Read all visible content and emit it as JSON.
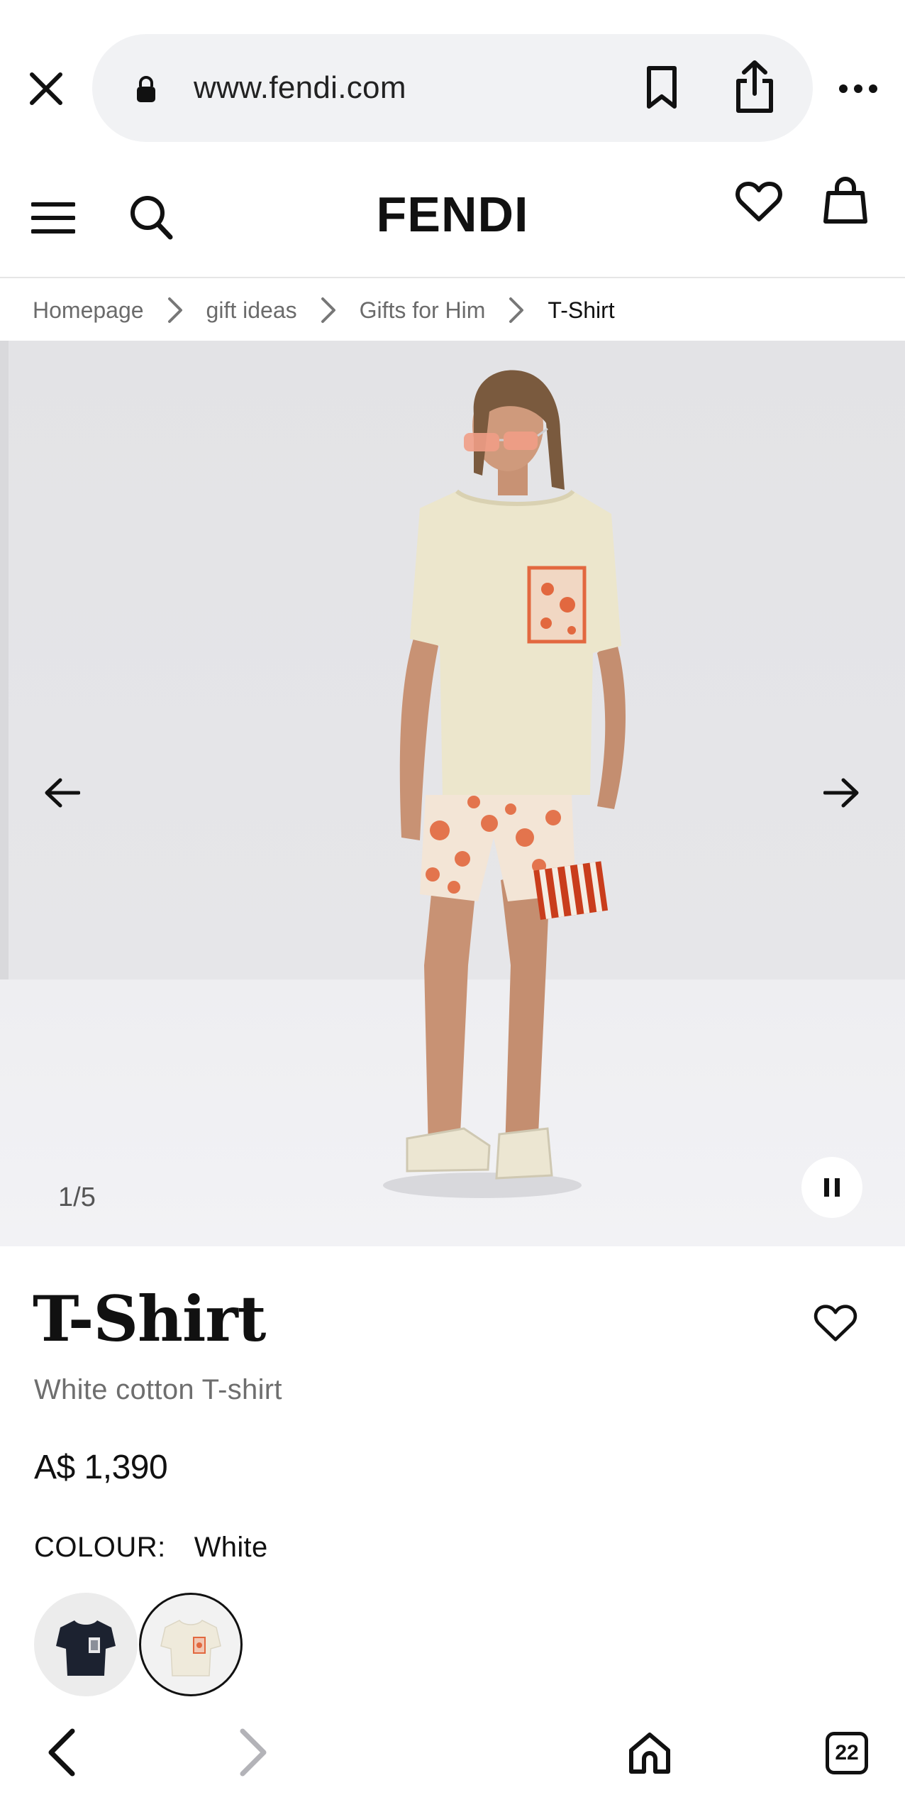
{
  "browser": {
    "url": "www.fendi.com",
    "tab_count": "22",
    "icons": {
      "close": "close-icon",
      "lock": "lock-icon",
      "bookmark": "bookmark-icon",
      "share": "share-icon",
      "more": "more-icon",
      "back": "back-icon",
      "forward": "forward-icon",
      "home": "home-icon",
      "tabs": "tabs-icon"
    }
  },
  "header": {
    "logo": "FENDI",
    "icons": {
      "menu": "hamburger-menu-icon",
      "search": "search-icon",
      "wishlist": "heart-icon",
      "bag": "shopping-bag-icon"
    }
  },
  "breadcrumb": {
    "items": [
      "Homepage",
      "gift ideas",
      "Gifts for Him",
      "T-Shirt"
    ]
  },
  "gallery": {
    "counter": "1/5",
    "current": 1,
    "total": 5
  },
  "product": {
    "title": "T-Shirt",
    "subtitle": "White cotton T-shirt",
    "price": "A$ 1,390",
    "colour_label": "COLOUR:",
    "colour_value": "White",
    "swatches": [
      {
        "colour": "black",
        "selected": false
      },
      {
        "colour": "white",
        "selected": true
      }
    ]
  },
  "colors": {
    "text": "#111111",
    "muted": "#6b6b6b",
    "urlbar_bg": "#f1f2f4",
    "accent_print": "#e2683f"
  }
}
